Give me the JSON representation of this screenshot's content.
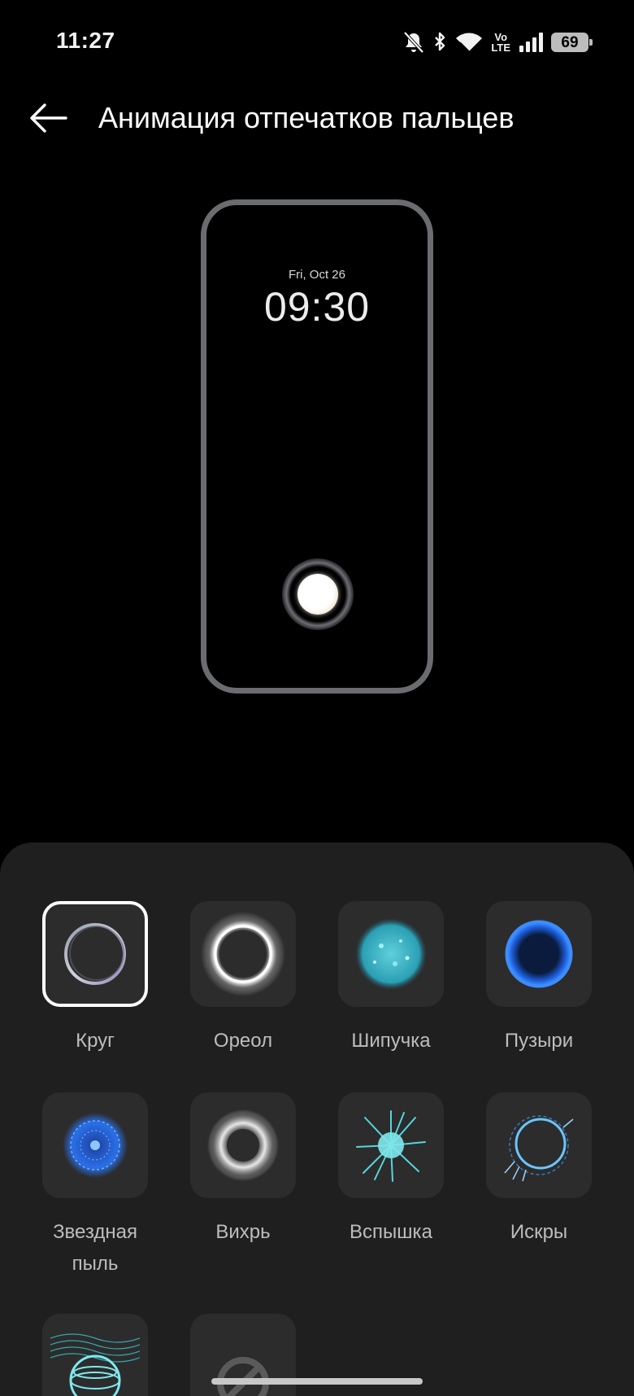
{
  "status_bar": {
    "time": "11:27",
    "volte_top": "Vo",
    "volte_bottom": "LTE",
    "battery": "69"
  },
  "header": {
    "back_icon": "arrow-left-icon",
    "title": "Анимация отпечатков пальцев"
  },
  "preview": {
    "date": "Fri, Oct 26",
    "clock": "09:30"
  },
  "animations": [
    {
      "label": "Круг",
      "icon": "circle-ring-icon",
      "selected": true
    },
    {
      "label": "Ореол",
      "icon": "halo-icon",
      "selected": false
    },
    {
      "label": "Шипучка",
      "icon": "fizz-icon",
      "selected": false
    },
    {
      "label": "Пузыри",
      "icon": "bubble-icon",
      "selected": false
    },
    {
      "label": "Звездная пыль",
      "icon": "stardust-icon",
      "selected": false
    },
    {
      "label": "Вихрь",
      "icon": "whirl-icon",
      "selected": false
    },
    {
      "label": "Вспышка",
      "icon": "burst-icon",
      "selected": false
    },
    {
      "label": "Искры",
      "icon": "sparks-icon",
      "selected": false
    },
    {
      "label": "",
      "icon": "wave-sphere-icon",
      "selected": false
    },
    {
      "label": "",
      "icon": "none-icon",
      "selected": false
    }
  ],
  "colors": {
    "background": "#000000",
    "sheet": "#1f1f1f",
    "tile": "#2c2c2c",
    "label": "#bdbdbd",
    "selected_border": "#ffffff",
    "accent_blue": "#2f7df5",
    "accent_cyan": "#4ad3d8"
  }
}
